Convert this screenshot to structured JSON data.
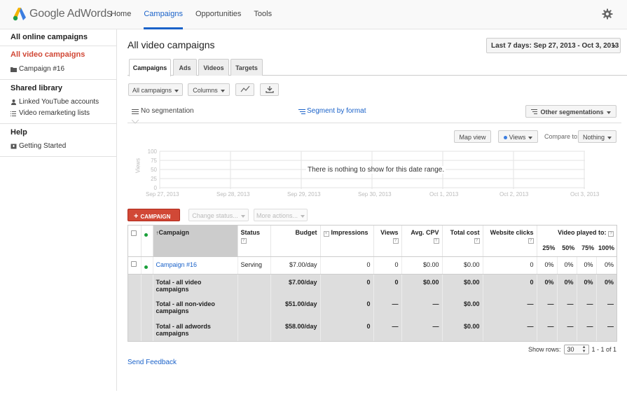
{
  "header": {
    "brand": "Google AdWords",
    "nav": [
      "Home",
      "Campaigns",
      "Opportunities",
      "Tools"
    ],
    "active_nav": "Campaigns"
  },
  "sidebar": {
    "all_online": "All online campaigns",
    "all_video": "All video campaigns",
    "campaign_item": "Campaign #16",
    "shared_library": "Shared library",
    "linked_youtube": "Linked YouTube accounts",
    "video_remarketing": "Video remarketing lists",
    "help": "Help",
    "getting_started": "Getting Started"
  },
  "main": {
    "title": "All video campaigns",
    "date_range": "Last 7 days: Sep 27, 2013 - Oct 3, 2013",
    "tabs": [
      "Campaigns",
      "Ads",
      "Videos",
      "Targets"
    ],
    "toolbar": {
      "all_campaigns": "All campaigns",
      "columns": "Columns"
    },
    "segmentation": {
      "none": "No segmentation",
      "by_format": "Segment by format",
      "other": "Other segmentations"
    },
    "chart_controls": {
      "map_view": "Map view",
      "views": "Views",
      "compare_to": "Compare to:",
      "nothing": "Nothing"
    },
    "chart": {
      "y_label": "Views",
      "y_ticks": [
        "100",
        "75",
        "50",
        "25",
        "0"
      ],
      "x_ticks": [
        "Sep 27, 2013",
        "Sep 28, 2013",
        "Sep 29, 2013",
        "Sep 30, 2013",
        "Oct 1, 2013",
        "Oct 2, 2013",
        "Oct 3, 2013"
      ],
      "empty_message": "There is nothing to show for this date range."
    },
    "actions": {
      "new_campaign": "CAMPAIGN",
      "change_status": "Change status...",
      "more_actions": "More actions..."
    },
    "table": {
      "headers": {
        "campaign": "Campaign",
        "status": "Status",
        "budget": "Budget",
        "impressions": "Impressions",
        "views": "Views",
        "avg_cpv": "Avg. CPV",
        "total_cost": "Total cost",
        "website_clicks": "Website clicks",
        "video_played": "Video played to:",
        "p25": "25%",
        "p50": "50%",
        "p75": "75%",
        "p100": "100%"
      },
      "rows": [
        {
          "campaign": "Campaign #16",
          "status": "Serving",
          "budget": "$7.00/day",
          "impressions": "0",
          "views": "0",
          "avg_cpv": "$0.00",
          "total_cost": "$0.00",
          "website_clicks": "0",
          "p25": "0%",
          "p50": "0%",
          "p75": "0%",
          "p100": "0%"
        }
      ],
      "totals": [
        {
          "label": "Total - all video campaigns",
          "budget": "$7.00/day",
          "impressions": "0",
          "views": "0",
          "avg_cpv": "$0.00",
          "total_cost": "$0.00",
          "website_clicks": "0",
          "p25": "0%",
          "p50": "0%",
          "p75": "0%",
          "p100": "0%"
        },
        {
          "label": "Total - all non-video campaigns",
          "budget": "$51.00/day",
          "impressions": "0",
          "views": "—",
          "avg_cpv": "—",
          "total_cost": "$0.00",
          "website_clicks": "—",
          "p25": "—",
          "p50": "—",
          "p75": "—",
          "p100": "—"
        },
        {
          "label": "Total - all adwords campaigns",
          "budget": "$58.00/day",
          "impressions": "0",
          "views": "—",
          "avg_cpv": "—",
          "total_cost": "$0.00",
          "website_clicks": "—",
          "p25": "—",
          "p50": "—",
          "p75": "—",
          "p100": "—"
        }
      ]
    },
    "pager": {
      "show_rows": "Show rows:",
      "rows_value": "30",
      "range": "1 - 1 of 1"
    },
    "send_feedback": "Send Feedback"
  },
  "colors": {
    "accent_blue": "#1a62c9",
    "red": "#d14836",
    "serving_green": "#1aa03a"
  }
}
